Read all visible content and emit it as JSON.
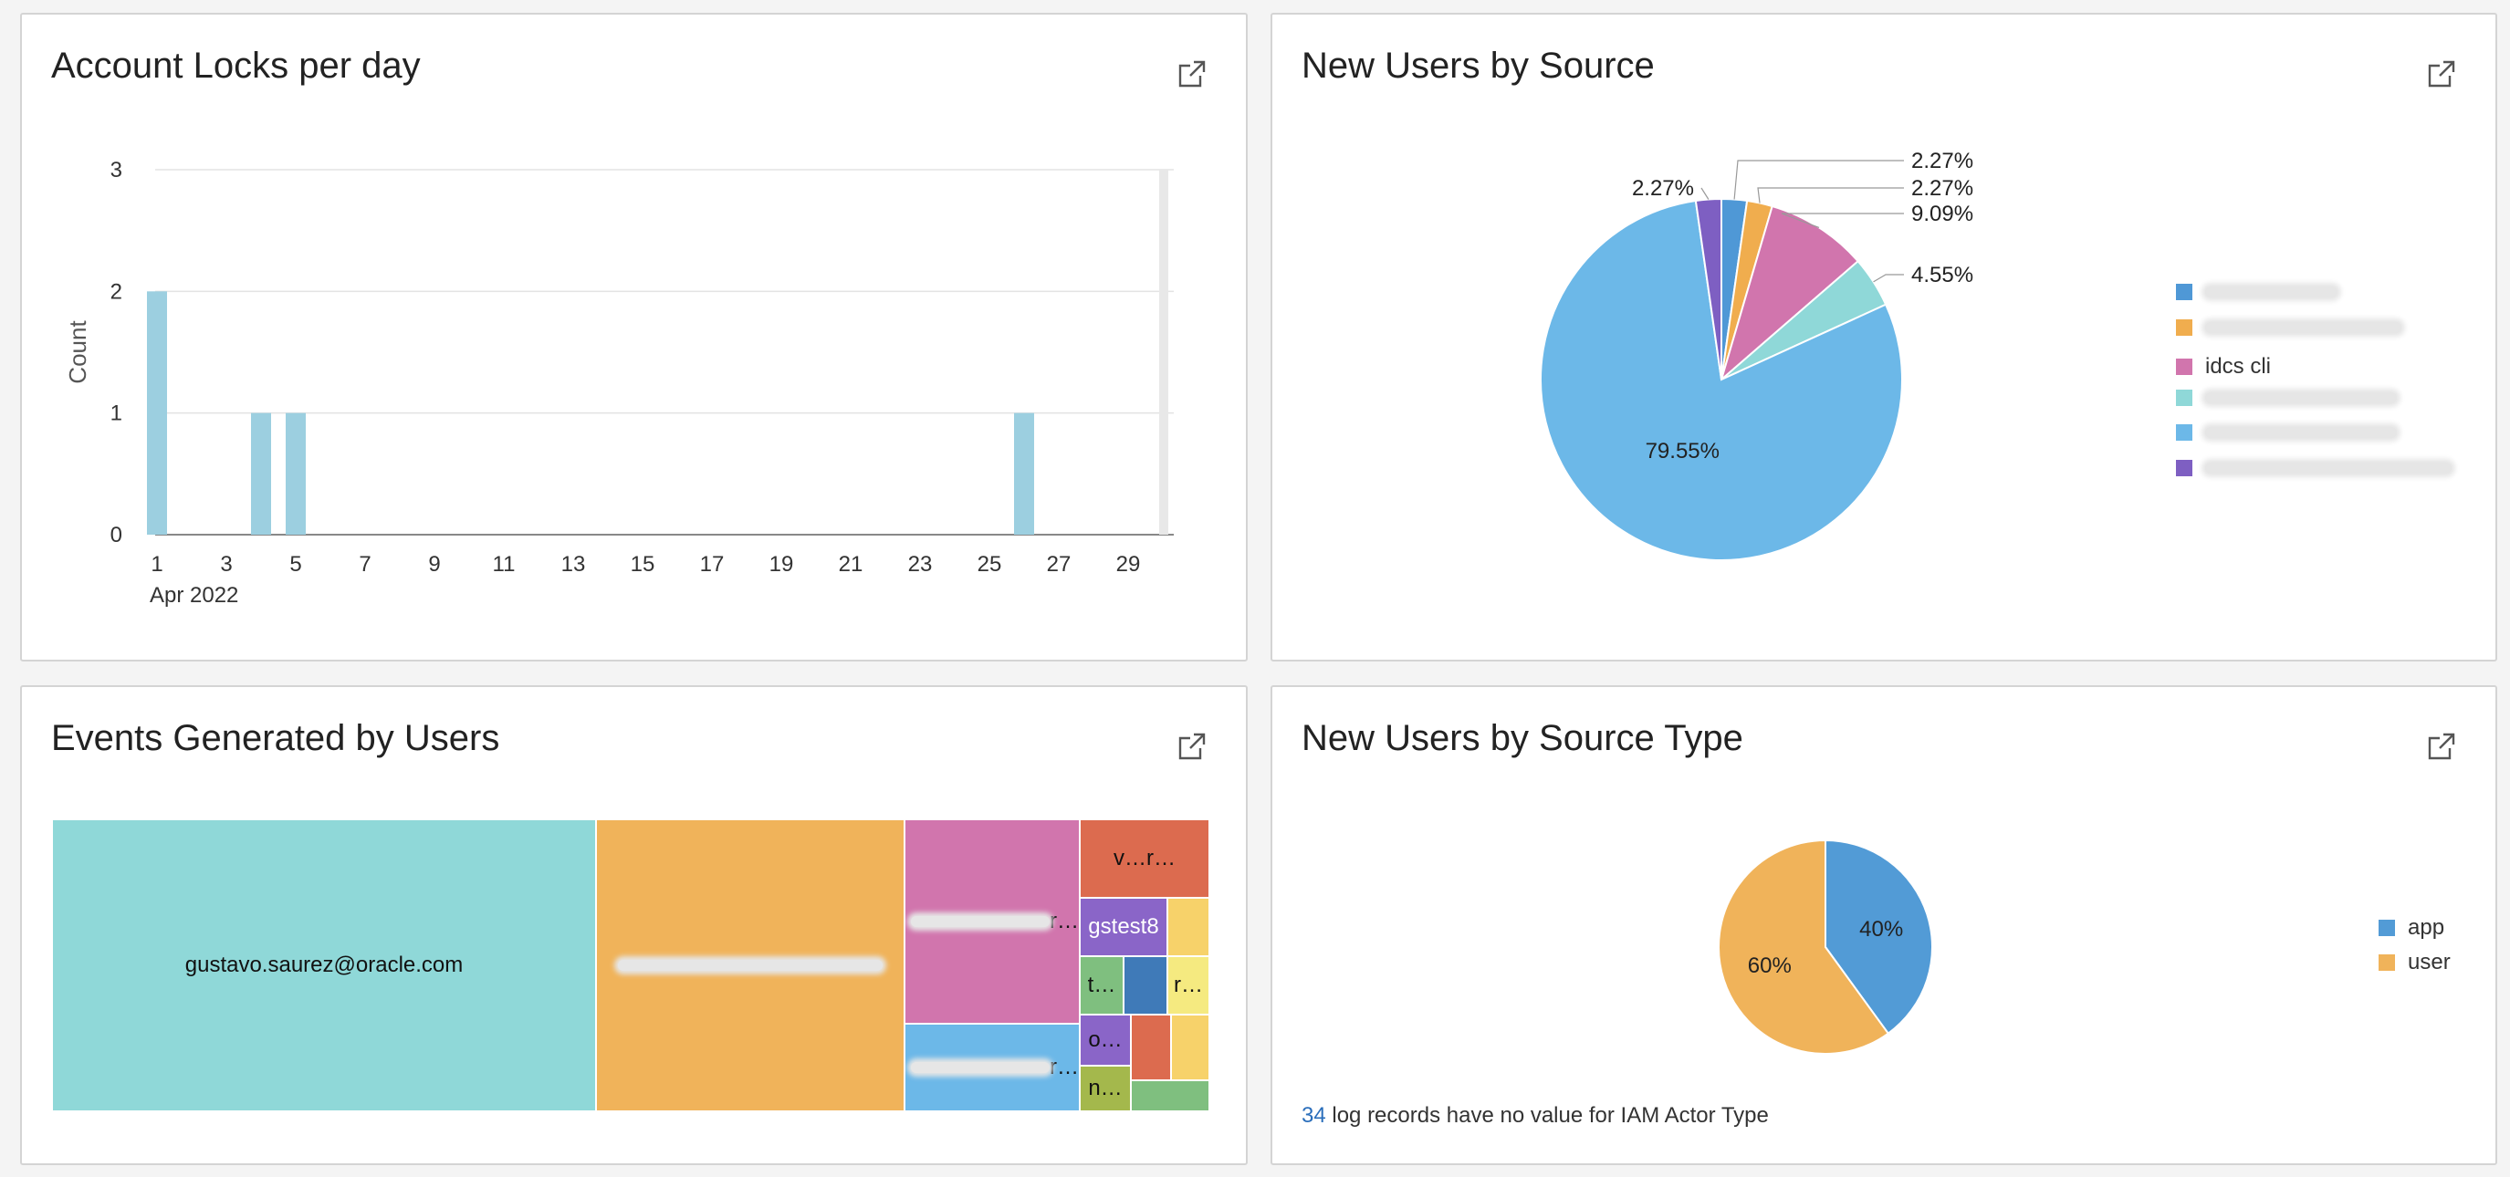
{
  "panels": {
    "locks": {
      "title": "Account Locks per day"
    },
    "source": {
      "title": "New Users by Source"
    },
    "events": {
      "title": "Events Generated by Users"
    },
    "stype": {
      "title": "New Users by Source Type"
    }
  },
  "source_type_note": {
    "count": "34",
    "text": " log records have no value for IAM Actor Type"
  },
  "events_labels": {
    "gustavo": "gustavo.saurez@oracle.com",
    "orange_big": "",
    "pink": "r…",
    "blue": "r…",
    "red_top": "v…r…",
    "purple": "gstest8",
    "green_small": "t…",
    "yellow_right": "r…",
    "purple_small": "o…",
    "olive": "n…"
  },
  "chart_data": [
    {
      "type": "bar",
      "title": "Account Locks per day",
      "ylabel": "Count",
      "xlabel": "Apr 2022",
      "x_ticks": [
        "1",
        "3",
        "5",
        "7",
        "9",
        "11",
        "13",
        "15",
        "17",
        "19",
        "21",
        "23",
        "25",
        "27",
        "29"
      ],
      "x_range": [
        1,
        30
      ],
      "y_ticks": [
        "0",
        "1",
        "2",
        "3"
      ],
      "ylim": [
        0,
        3
      ],
      "grid": true,
      "color": "#9ccfe0",
      "points": [
        {
          "x": 1,
          "y": 2
        },
        {
          "x": 4,
          "y": 1
        },
        {
          "x": 5,
          "y": 1
        },
        {
          "x": 26,
          "y": 1
        }
      ]
    },
    {
      "type": "pie",
      "title": "New Users by Source",
      "legend_position": "right",
      "slices": [
        {
          "name": "",
          "value": 2.27,
          "label": "2.27%",
          "color": "#4f98d6"
        },
        {
          "name": "",
          "value": 2.27,
          "label": "2.27%",
          "color": "#f0ad4e"
        },
        {
          "name": "idcs cli",
          "value": 9.09,
          "label": "9.09%",
          "color": "#d175ad"
        },
        {
          "name": "",
          "value": 4.55,
          "label": "4.55%",
          "color": "#8fd8d8"
        },
        {
          "name": "",
          "value": 79.55,
          "label": "79.55%",
          "color": "#6cb8e8"
        },
        {
          "name": "",
          "value": 2.27,
          "label": "2.27%",
          "color": "#7e5fc2"
        }
      ]
    },
    {
      "type": "pie",
      "title": "New Users by Source Type",
      "legend_position": "right",
      "slices": [
        {
          "name": "app",
          "value": 40,
          "label": "40%",
          "color": "#529bd6"
        },
        {
          "name": "user",
          "value": 60,
          "label": "60%",
          "color": "#f0b35a"
        }
      ]
    }
  ],
  "colors": {
    "treemap_teal": "#8fd8d8",
    "treemap_orange": "#f0b35a",
    "treemap_pink": "#d175ad",
    "treemap_blue": "#6cb8e8",
    "treemap_red": "#dc6b4f",
    "treemap_purple": "#8a65c8",
    "treemap_yellow": "#f7d26a",
    "treemap_green": "#7fbf7f",
    "treemap_navy": "#3f7ab8",
    "treemap_lightyellow": "#f5ea80",
    "treemap_olive": "#a4b84c"
  }
}
